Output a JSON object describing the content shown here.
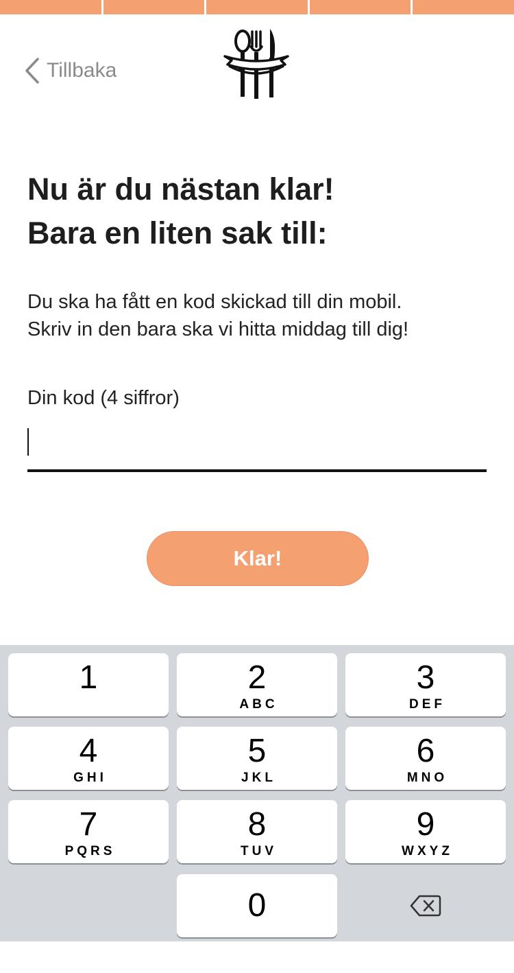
{
  "progress": {
    "total_steps": 5,
    "completed_steps": 5,
    "color": "#F4A070"
  },
  "nav": {
    "back_label": "Tillbaka"
  },
  "logo": {
    "icon": "cutlery-banner-icon"
  },
  "heading": {
    "line1": "Nu är du nästan klar!",
    "line2": "Bara en liten sak till:"
  },
  "intro": {
    "line1": "Du ska ha fått en kod skickad till din mobil.",
    "line2": "Skriv in den bara ska vi hitta middag till dig!"
  },
  "code_field": {
    "label": "Din kod (4 siffror)",
    "value": ""
  },
  "submit_label": "Klar!",
  "accent_color": "#F4A070",
  "keypad": {
    "keys": [
      {
        "digit": "1",
        "letters": ""
      },
      {
        "digit": "2",
        "letters": "ABC"
      },
      {
        "digit": "3",
        "letters": "DEF"
      },
      {
        "digit": "4",
        "letters": "GHI"
      },
      {
        "digit": "5",
        "letters": "JKL"
      },
      {
        "digit": "6",
        "letters": "MNO"
      },
      {
        "digit": "7",
        "letters": "PQRS"
      },
      {
        "digit": "8",
        "letters": "TUV"
      },
      {
        "digit": "9",
        "letters": "WXYZ"
      },
      {
        "digit": "0",
        "letters": ""
      }
    ],
    "delete_icon": "backspace-icon"
  }
}
